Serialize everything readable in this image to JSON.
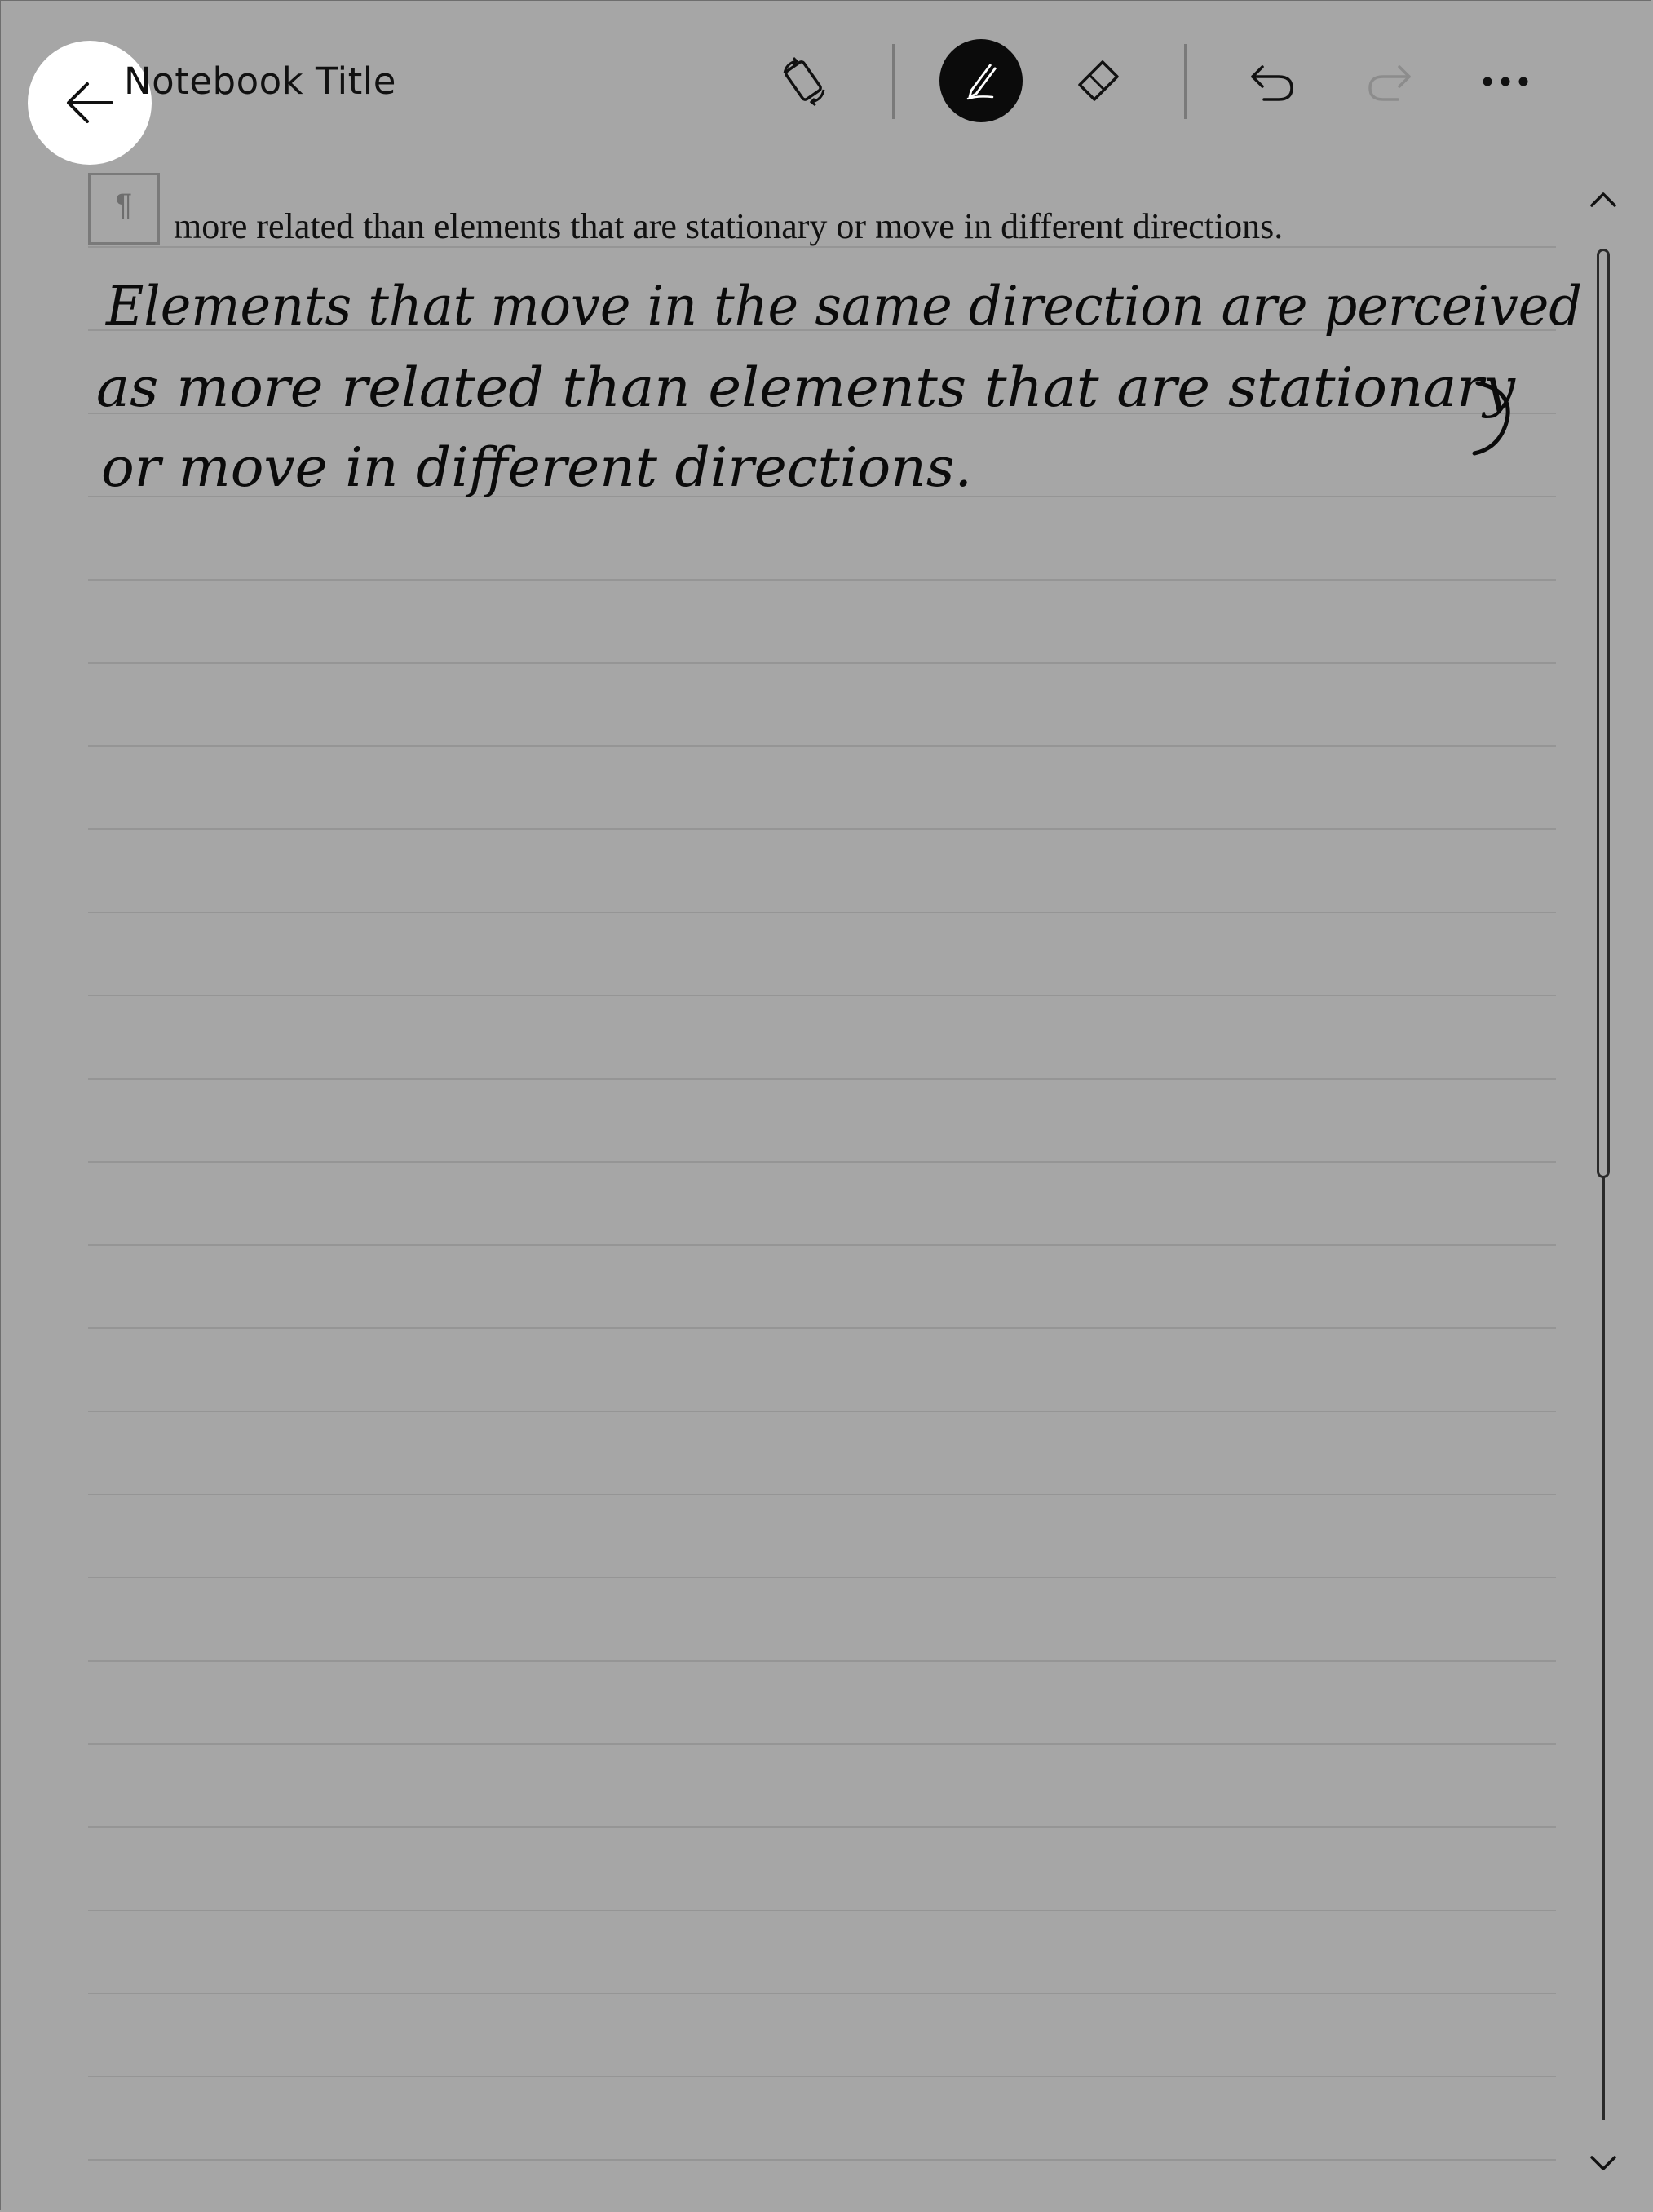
{
  "header": {
    "title": "Notebook Title"
  },
  "icons": {
    "back": "back-arrow-icon",
    "rotate": "rotate-device-icon",
    "pen": "pen-icon",
    "eraser": "eraser-icon",
    "undo": "undo-icon",
    "redo": "redo-icon",
    "more": "more-options-icon",
    "paragraph": "paragraph-icon",
    "scroll_up": "chevron-up-icon",
    "scroll_down": "chevron-down-icon"
  },
  "colors": {
    "background": "#a6a6a6",
    "ink": "#0b0b0b",
    "rule": "#959595"
  },
  "toolbar": {
    "active_tool": "pen",
    "redo_enabled": false
  },
  "page": {
    "paragraph_symbol": "¶",
    "converted_text": "more related than elements that are stationary or move in different directions.",
    "handwritten_lines": [
      "Elements that move in the same direction are perceived",
      "as more related than elements that are stationary",
      "or move in different directions."
    ]
  }
}
